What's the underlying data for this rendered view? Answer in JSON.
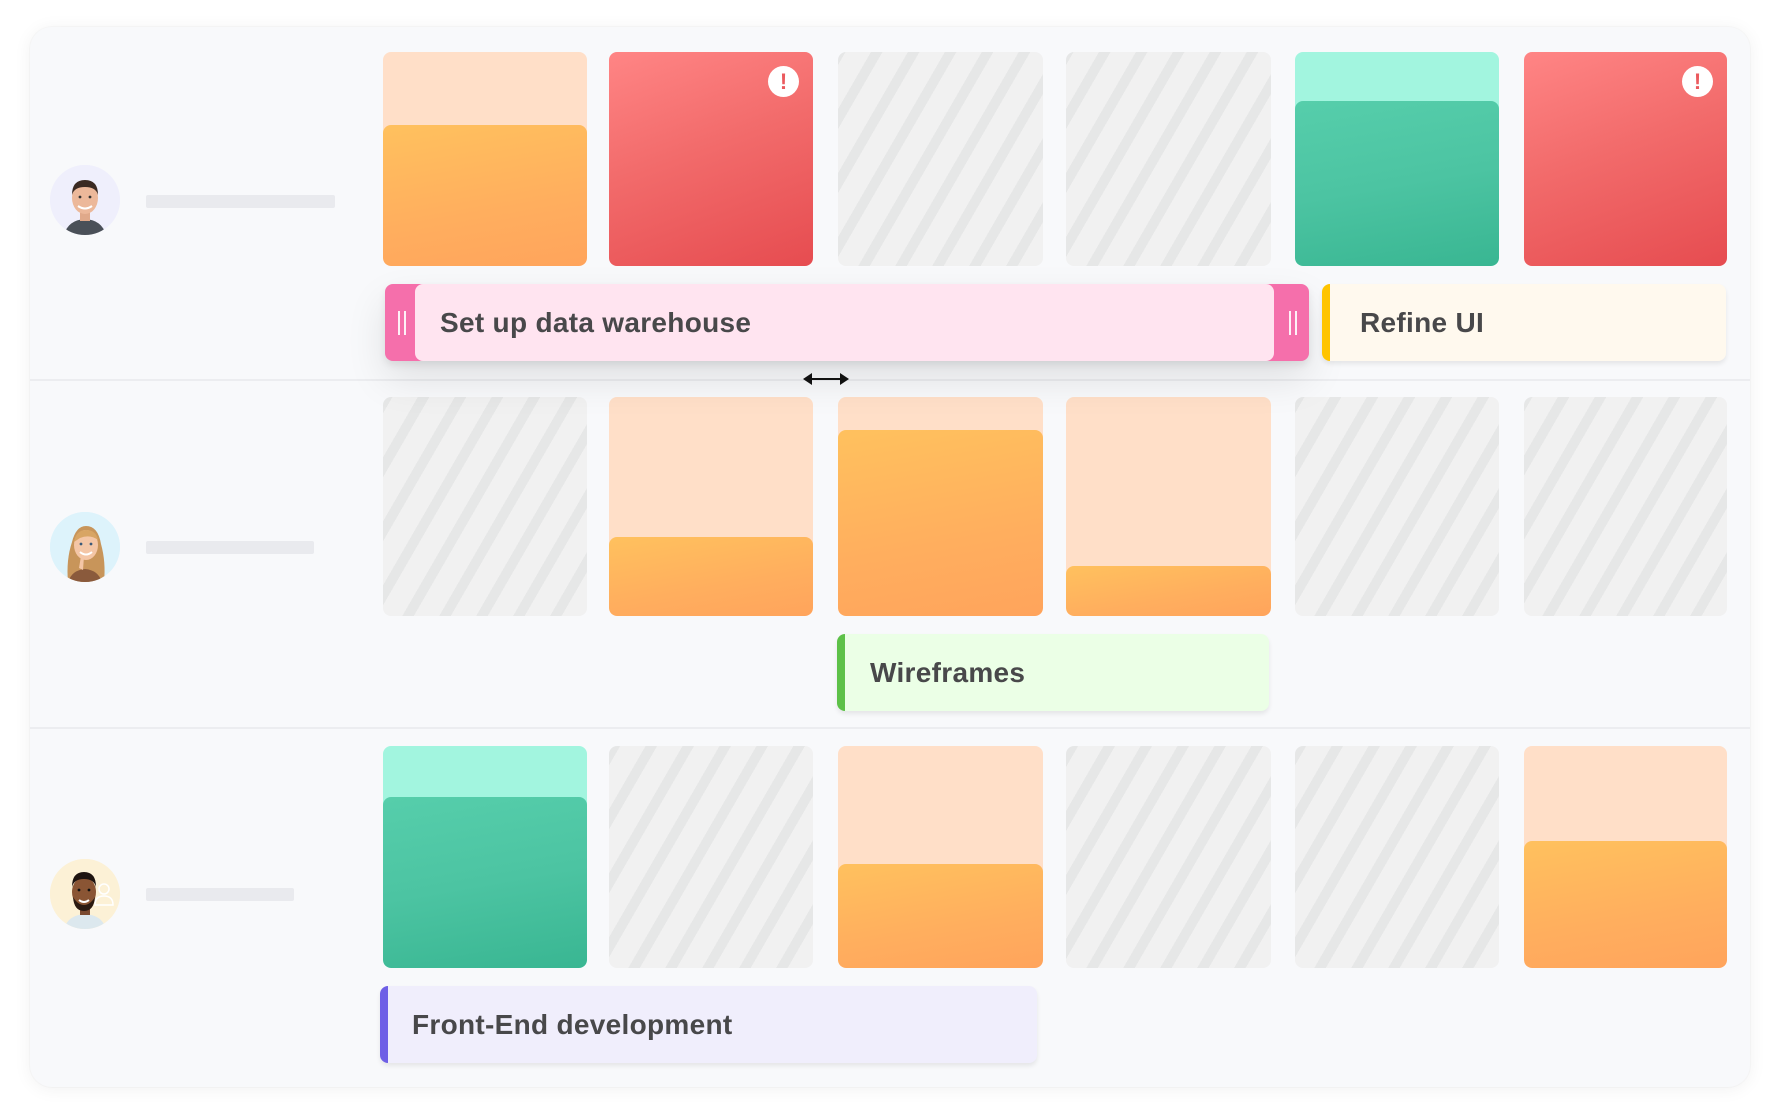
{
  "colors": {
    "panel_bg": "#F8F9FB",
    "hatch_light": "#F1F1F1",
    "hatch_dark": "#E6E7E7",
    "orange_light": "#FFDFC8",
    "orange_fill": "#FFAE5E",
    "green_light": "#A2F5DF",
    "green_fill": "#4CC4A2",
    "red": "#F26B6B",
    "text": "#48484A"
  },
  "rows": [
    {
      "avatar": {
        "icon": "person-avatar-man",
        "bg": "#EFEFFC"
      },
      "days": [
        {
          "type": "workload",
          "color": "orange",
          "load": 0.66
        },
        {
          "type": "overload",
          "color": "red",
          "alert": "!"
        },
        {
          "type": "unavailable"
        },
        {
          "type": "unavailable"
        },
        {
          "type": "workload",
          "color": "green",
          "load": 0.77
        },
        {
          "type": "overload",
          "color": "red",
          "alert": "!"
        }
      ],
      "tasks": [
        {
          "label": "Set up data warehouse",
          "bg": "#FFE4F0",
          "accent": "#F56FAB",
          "state": "resizing"
        },
        {
          "label": "Refine UI",
          "bg": "#FFF9EE",
          "accent": "#FFC400"
        }
      ]
    },
    {
      "avatar": {
        "icon": "person-avatar-woman",
        "bg": "#DDF3FB"
      },
      "days": [
        {
          "type": "unavailable"
        },
        {
          "type": "workload",
          "color": "orange",
          "load": 0.36
        },
        {
          "type": "workload",
          "color": "orange",
          "load": 0.85
        },
        {
          "type": "workload",
          "color": "orange",
          "load": 0.23
        },
        {
          "type": "unavailable"
        },
        {
          "type": "unavailable"
        }
      ],
      "tasks": [
        {
          "label": "Wireframes",
          "bg": "#EBFFE6",
          "accent": "#5DC148"
        }
      ]
    },
    {
      "avatar": {
        "icon": "person-avatar-man",
        "bg": "#FCF1D6"
      },
      "days": [
        {
          "type": "workload",
          "color": "green",
          "load": 0.77
        },
        {
          "type": "unavailable"
        },
        {
          "type": "workload",
          "color": "orange",
          "load": 0.47
        },
        {
          "type": "unavailable"
        },
        {
          "type": "unavailable"
        },
        {
          "type": "workload",
          "color": "orange",
          "load": 0.57
        }
      ],
      "tasks": [
        {
          "label": "Front-End development",
          "bg": "#F0EEFC",
          "accent": "#6E5FE6"
        }
      ]
    }
  ],
  "cursor": {
    "icon": "resize-horizontal-icon"
  }
}
